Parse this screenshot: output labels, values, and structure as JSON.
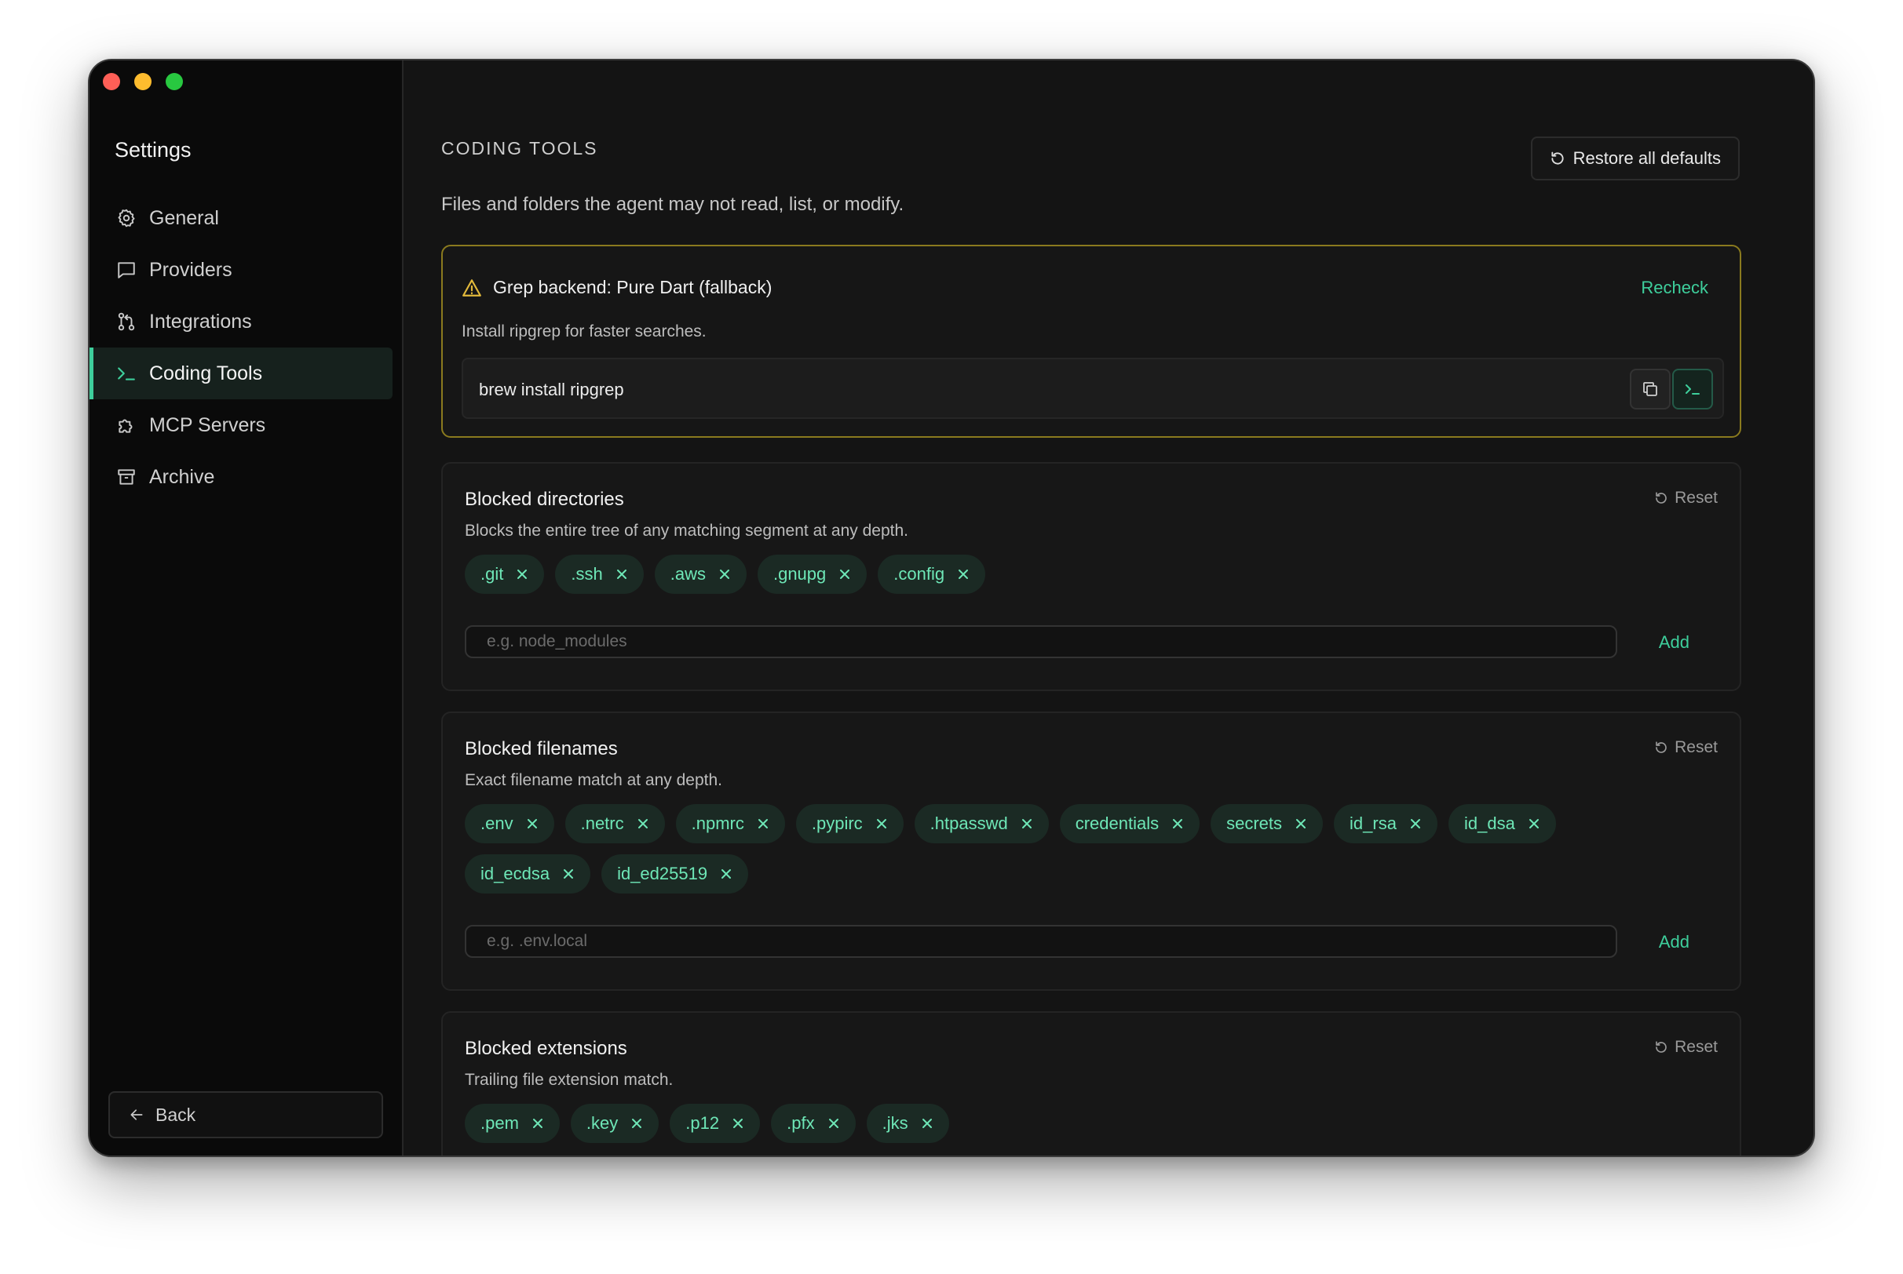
{
  "sidebar": {
    "title": "Settings",
    "items": [
      {
        "label": "General",
        "icon": "gear-icon"
      },
      {
        "label": "Providers",
        "icon": "message-icon"
      },
      {
        "label": "Integrations",
        "icon": "git-branch-icon"
      },
      {
        "label": "Coding Tools",
        "icon": "terminal-icon",
        "active": true
      },
      {
        "label": "MCP Servers",
        "icon": "puzzle-icon"
      },
      {
        "label": "Archive",
        "icon": "archive-icon"
      }
    ],
    "back_label": "Back"
  },
  "header": {
    "section_label": "CODING TOOLS",
    "restore_label": "Restore all defaults",
    "subtitle": "Files and folders the agent may not read, list, or modify."
  },
  "warning": {
    "title": "Grep backend: Pure Dart (fallback)",
    "recheck_label": "Recheck",
    "description": "Install ripgrep for faster searches.",
    "command": "brew install ripgrep"
  },
  "blocked_directories": {
    "title": "Blocked directories",
    "description": "Blocks the entire tree of any matching segment at any depth.",
    "reset_label": "Reset",
    "chips": [
      ".git",
      ".ssh",
      ".aws",
      ".gnupg",
      ".config"
    ],
    "placeholder": "e.g. node_modules",
    "add_label": "Add"
  },
  "blocked_filenames": {
    "title": "Blocked filenames",
    "description": "Exact filename match at any depth.",
    "reset_label": "Reset",
    "chips": [
      ".env",
      ".netrc",
      ".npmrc",
      ".pypirc",
      ".htpasswd",
      "credentials",
      "secrets",
      "id_rsa",
      "id_dsa",
      "id_ecdsa",
      "id_ed25519"
    ],
    "placeholder": "e.g. .env.local",
    "add_label": "Add"
  },
  "blocked_extensions": {
    "title": "Blocked extensions",
    "description": "Trailing file extension match.",
    "reset_label": "Reset",
    "chips": [
      ".pem",
      ".key",
      ".p12",
      ".pfx",
      ".jks"
    ]
  },
  "colors": {
    "accent": "#3ecf9c",
    "warning_border": "#8a7a1e",
    "chip_bg": "#1b2a24",
    "chip_text": "#6ee7b7"
  }
}
